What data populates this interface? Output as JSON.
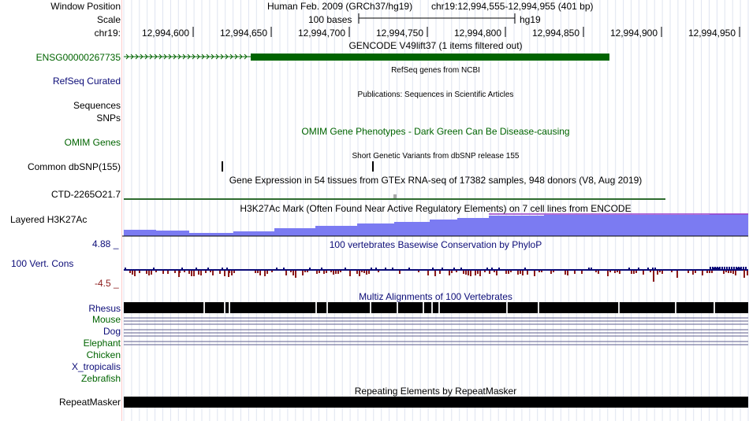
{
  "header": {
    "window_position_label": "Window Position",
    "scale_label": "Scale",
    "chrom_label": "chr19:",
    "assembly": "Human Feb. 2009 (GRCh37/hg19)",
    "position": "chr19:12,994,555-12,994,955 (401 bp)",
    "scale_value": "100 bases",
    "scale_assembly": "hg19",
    "ticks": [
      "12,994,600",
      "12,994,650",
      "12,994,700",
      "12,994,750",
      "12,994,800",
      "12,994,850",
      "12,994,900",
      "12,994,950"
    ]
  },
  "tracks": {
    "gencode": {
      "title": "GENCODE V49lift37 (1 items filtered out)",
      "label": "ENSG00000267735",
      "color": "#006400"
    },
    "refseq": {
      "label": "RefSeq Curated",
      "subtitle": "RefSeq genes from NCBI",
      "color": "#0c0c78"
    },
    "publications": {
      "label": "Sequences",
      "subtitle": "Publications: Sequences in Scientific Articles"
    },
    "snps_pub": {
      "label": "SNPs"
    },
    "omim": {
      "label": "OMIM Genes",
      "title": "OMIM Gene Phenotypes - Dark Green Can Be Disease-causing",
      "color": "#006400"
    },
    "dbsnp": {
      "label": "Common dbSNP(155)",
      "subtitle": "Short Genetic Variants from dbSNP release 155"
    },
    "gtex": {
      "label": "CTD-2265O21.7",
      "title": "Gene Expression in 54 tissues from GTEx RNA-seq of 17382 samples, 948 donors (V8, Aug 2019)"
    },
    "h3k27ac": {
      "label": "Layered H3K27Ac",
      "title": "H3K27Ac Mark (Often Found Near Active Regulatory Elements) on 7 cell lines from ENCODE",
      "color": "#7b7bf2"
    },
    "cons": {
      "label": "100 Vert. Cons",
      "title": "100 vertebrates Basewise Conservation by PhyloP",
      "max": "4.88 _",
      "min": "-4.5 _",
      "color": "#0c0c78"
    },
    "multiz": {
      "title": "Multiz Alignments of 100 Vertebrates",
      "species": [
        "Rhesus",
        "Mouse",
        "Dog",
        "Elephant",
        "Chicken",
        "X_tropicalis",
        "Zebrafish"
      ],
      "color": "#0c0c78"
    },
    "repeatmasker": {
      "label": "RepeatMasker",
      "title": "Repeating Elements by RepeatMasker"
    }
  }
}
